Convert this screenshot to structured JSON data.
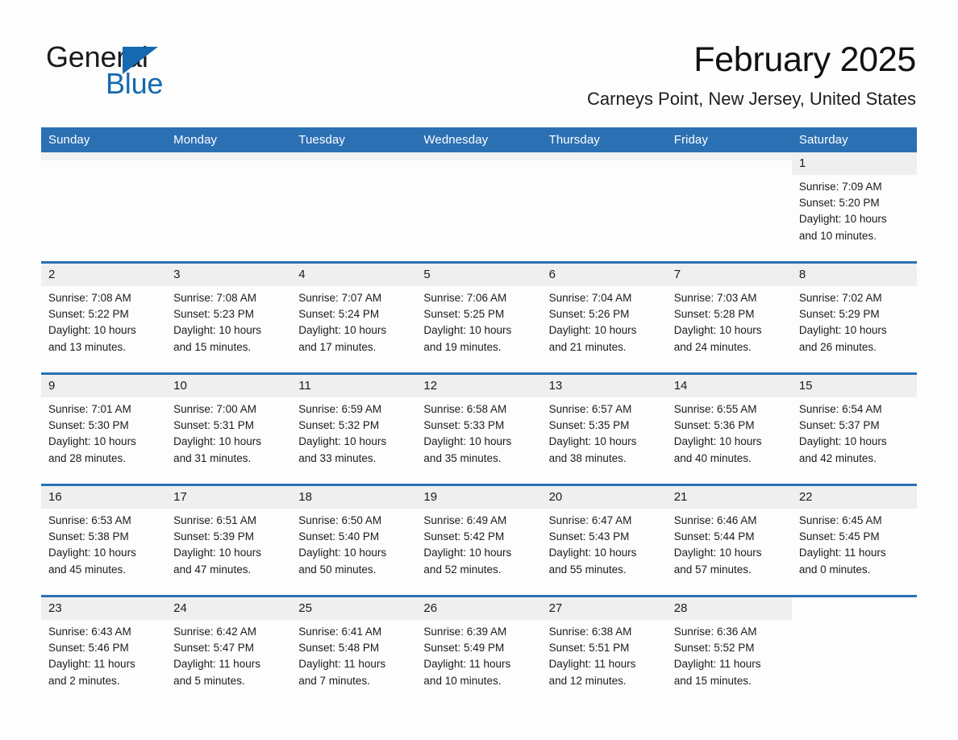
{
  "brand": {
    "name_part1": "General",
    "name_part2": "Blue",
    "triangle_color": "#1569b0"
  },
  "header": {
    "month_title": "February 2025",
    "location": "Carneys Point, New Jersey, United States",
    "accent_color": "#2c70b4"
  },
  "calendar": {
    "weekday_headers": [
      "Sunday",
      "Monday",
      "Tuesday",
      "Wednesday",
      "Thursday",
      "Friday",
      "Saturday"
    ],
    "weeks": [
      [
        {
          "day": "",
          "sunrise": "",
          "sunset": "",
          "daylight_line1": "",
          "daylight_line2": ""
        },
        {
          "day": "",
          "sunrise": "",
          "sunset": "",
          "daylight_line1": "",
          "daylight_line2": ""
        },
        {
          "day": "",
          "sunrise": "",
          "sunset": "",
          "daylight_line1": "",
          "daylight_line2": ""
        },
        {
          "day": "",
          "sunrise": "",
          "sunset": "",
          "daylight_line1": "",
          "daylight_line2": ""
        },
        {
          "day": "",
          "sunrise": "",
          "sunset": "",
          "daylight_line1": "",
          "daylight_line2": ""
        },
        {
          "day": "",
          "sunrise": "",
          "sunset": "",
          "daylight_line1": "",
          "daylight_line2": ""
        },
        {
          "day": "1",
          "sunrise": "Sunrise: 7:09 AM",
          "sunset": "Sunset: 5:20 PM",
          "daylight_line1": "Daylight: 10 hours",
          "daylight_line2": "and 10 minutes."
        }
      ],
      [
        {
          "day": "2",
          "sunrise": "Sunrise: 7:08 AM",
          "sunset": "Sunset: 5:22 PM",
          "daylight_line1": "Daylight: 10 hours",
          "daylight_line2": "and 13 minutes."
        },
        {
          "day": "3",
          "sunrise": "Sunrise: 7:08 AM",
          "sunset": "Sunset: 5:23 PM",
          "daylight_line1": "Daylight: 10 hours",
          "daylight_line2": "and 15 minutes."
        },
        {
          "day": "4",
          "sunrise": "Sunrise: 7:07 AM",
          "sunset": "Sunset: 5:24 PM",
          "daylight_line1": "Daylight: 10 hours",
          "daylight_line2": "and 17 minutes."
        },
        {
          "day": "5",
          "sunrise": "Sunrise: 7:06 AM",
          "sunset": "Sunset: 5:25 PM",
          "daylight_line1": "Daylight: 10 hours",
          "daylight_line2": "and 19 minutes."
        },
        {
          "day": "6",
          "sunrise": "Sunrise: 7:04 AM",
          "sunset": "Sunset: 5:26 PM",
          "daylight_line1": "Daylight: 10 hours",
          "daylight_line2": "and 21 minutes."
        },
        {
          "day": "7",
          "sunrise": "Sunrise: 7:03 AM",
          "sunset": "Sunset: 5:28 PM",
          "daylight_line1": "Daylight: 10 hours",
          "daylight_line2": "and 24 minutes."
        },
        {
          "day": "8",
          "sunrise": "Sunrise: 7:02 AM",
          "sunset": "Sunset: 5:29 PM",
          "daylight_line1": "Daylight: 10 hours",
          "daylight_line2": "and 26 minutes."
        }
      ],
      [
        {
          "day": "9",
          "sunrise": "Sunrise: 7:01 AM",
          "sunset": "Sunset: 5:30 PM",
          "daylight_line1": "Daylight: 10 hours",
          "daylight_line2": "and 28 minutes."
        },
        {
          "day": "10",
          "sunrise": "Sunrise: 7:00 AM",
          "sunset": "Sunset: 5:31 PM",
          "daylight_line1": "Daylight: 10 hours",
          "daylight_line2": "and 31 minutes."
        },
        {
          "day": "11",
          "sunrise": "Sunrise: 6:59 AM",
          "sunset": "Sunset: 5:32 PM",
          "daylight_line1": "Daylight: 10 hours",
          "daylight_line2": "and 33 minutes."
        },
        {
          "day": "12",
          "sunrise": "Sunrise: 6:58 AM",
          "sunset": "Sunset: 5:33 PM",
          "daylight_line1": "Daylight: 10 hours",
          "daylight_line2": "and 35 minutes."
        },
        {
          "day": "13",
          "sunrise": "Sunrise: 6:57 AM",
          "sunset": "Sunset: 5:35 PM",
          "daylight_line1": "Daylight: 10 hours",
          "daylight_line2": "and 38 minutes."
        },
        {
          "day": "14",
          "sunrise": "Sunrise: 6:55 AM",
          "sunset": "Sunset: 5:36 PM",
          "daylight_line1": "Daylight: 10 hours",
          "daylight_line2": "and 40 minutes."
        },
        {
          "day": "15",
          "sunrise": "Sunrise: 6:54 AM",
          "sunset": "Sunset: 5:37 PM",
          "daylight_line1": "Daylight: 10 hours",
          "daylight_line2": "and 42 minutes."
        }
      ],
      [
        {
          "day": "16",
          "sunrise": "Sunrise: 6:53 AM",
          "sunset": "Sunset: 5:38 PM",
          "daylight_line1": "Daylight: 10 hours",
          "daylight_line2": "and 45 minutes."
        },
        {
          "day": "17",
          "sunrise": "Sunrise: 6:51 AM",
          "sunset": "Sunset: 5:39 PM",
          "daylight_line1": "Daylight: 10 hours",
          "daylight_line2": "and 47 minutes."
        },
        {
          "day": "18",
          "sunrise": "Sunrise: 6:50 AM",
          "sunset": "Sunset: 5:40 PM",
          "daylight_line1": "Daylight: 10 hours",
          "daylight_line2": "and 50 minutes."
        },
        {
          "day": "19",
          "sunrise": "Sunrise: 6:49 AM",
          "sunset": "Sunset: 5:42 PM",
          "daylight_line1": "Daylight: 10 hours",
          "daylight_line2": "and 52 minutes."
        },
        {
          "day": "20",
          "sunrise": "Sunrise: 6:47 AM",
          "sunset": "Sunset: 5:43 PM",
          "daylight_line1": "Daylight: 10 hours",
          "daylight_line2": "and 55 minutes."
        },
        {
          "day": "21",
          "sunrise": "Sunrise: 6:46 AM",
          "sunset": "Sunset: 5:44 PM",
          "daylight_line1": "Daylight: 10 hours",
          "daylight_line2": "and 57 minutes."
        },
        {
          "day": "22",
          "sunrise": "Sunrise: 6:45 AM",
          "sunset": "Sunset: 5:45 PM",
          "daylight_line1": "Daylight: 11 hours",
          "daylight_line2": "and 0 minutes."
        }
      ],
      [
        {
          "day": "23",
          "sunrise": "Sunrise: 6:43 AM",
          "sunset": "Sunset: 5:46 PM",
          "daylight_line1": "Daylight: 11 hours",
          "daylight_line2": "and 2 minutes."
        },
        {
          "day": "24",
          "sunrise": "Sunrise: 6:42 AM",
          "sunset": "Sunset: 5:47 PM",
          "daylight_line1": "Daylight: 11 hours",
          "daylight_line2": "and 5 minutes."
        },
        {
          "day": "25",
          "sunrise": "Sunrise: 6:41 AM",
          "sunset": "Sunset: 5:48 PM",
          "daylight_line1": "Daylight: 11 hours",
          "daylight_line2": "and 7 minutes."
        },
        {
          "day": "26",
          "sunrise": "Sunrise: 6:39 AM",
          "sunset": "Sunset: 5:49 PM",
          "daylight_line1": "Daylight: 11 hours",
          "daylight_line2": "and 10 minutes."
        },
        {
          "day": "27",
          "sunrise": "Sunrise: 6:38 AM",
          "sunset": "Sunset: 5:51 PM",
          "daylight_line1": "Daylight: 11 hours",
          "daylight_line2": "and 12 minutes."
        },
        {
          "day": "28",
          "sunrise": "Sunrise: 6:36 AM",
          "sunset": "Sunset: 5:52 PM",
          "daylight_line1": "Daylight: 11 hours",
          "daylight_line2": "and 15 minutes."
        },
        {
          "day": "",
          "sunrise": "",
          "sunset": "",
          "daylight_line1": "",
          "daylight_line2": ""
        }
      ]
    ]
  }
}
